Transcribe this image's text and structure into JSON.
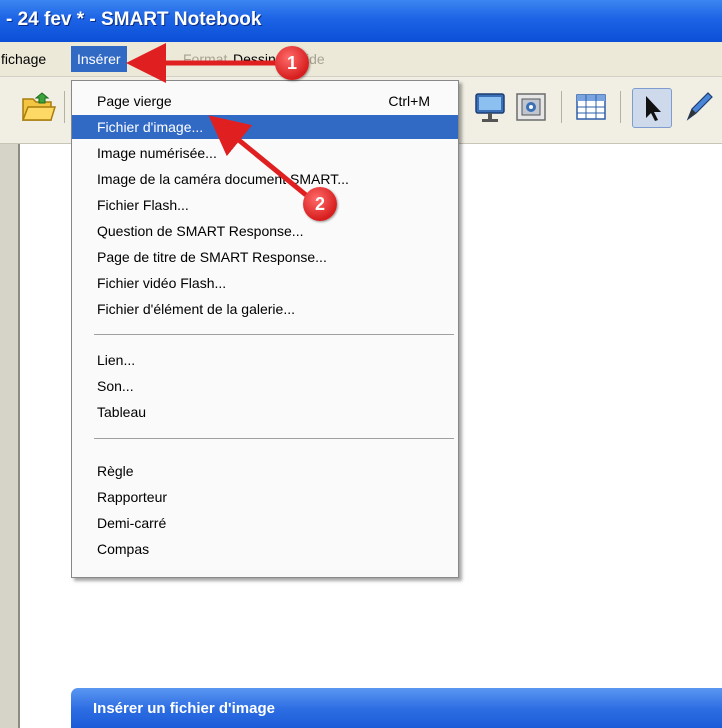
{
  "window": {
    "title": "- 24 fev * - SMART Notebook"
  },
  "menubar": {
    "items": [
      {
        "label": "fichage"
      },
      {
        "label": "Insérer"
      },
      {
        "label": "Format"
      },
      {
        "label": "Dessiner"
      },
      {
        "label": "ide"
      }
    ]
  },
  "dropdown": {
    "group1": [
      {
        "label": "Page vierge",
        "shortcut": "Ctrl+M"
      },
      {
        "label": "Fichier d'image..."
      },
      {
        "label": "Image numérisée..."
      },
      {
        "label": "Image de la caméra document SMART..."
      },
      {
        "label": "Fichier Flash..."
      },
      {
        "label": "Question de SMART Response..."
      },
      {
        "label": "Page de titre de SMART Response..."
      },
      {
        "label": "Fichier vidéo Flash..."
      },
      {
        "label": "Fichier d'élément de la galerie..."
      }
    ],
    "group2": [
      {
        "label": "Lien..."
      },
      {
        "label": "Son..."
      },
      {
        "label": "Tableau"
      }
    ],
    "group3": [
      {
        "label": "Règle"
      },
      {
        "label": "Rapporteur"
      },
      {
        "label": "Demi-carré"
      },
      {
        "label": "Compas"
      }
    ]
  },
  "dialog": {
    "title": "Insérer un fichier d'image"
  },
  "callouts": {
    "step1": "1",
    "step2": "2"
  },
  "colors": {
    "highlight": "#316ac5",
    "titlebar": "#1d63e6",
    "callout": "#d71e1e"
  },
  "toolbar": {
    "icons": [
      "folder-open-icon",
      "document-camera-icon",
      "screen-capture-icon",
      "table-icon",
      "select-arrow-icon",
      "pen-icon"
    ]
  }
}
